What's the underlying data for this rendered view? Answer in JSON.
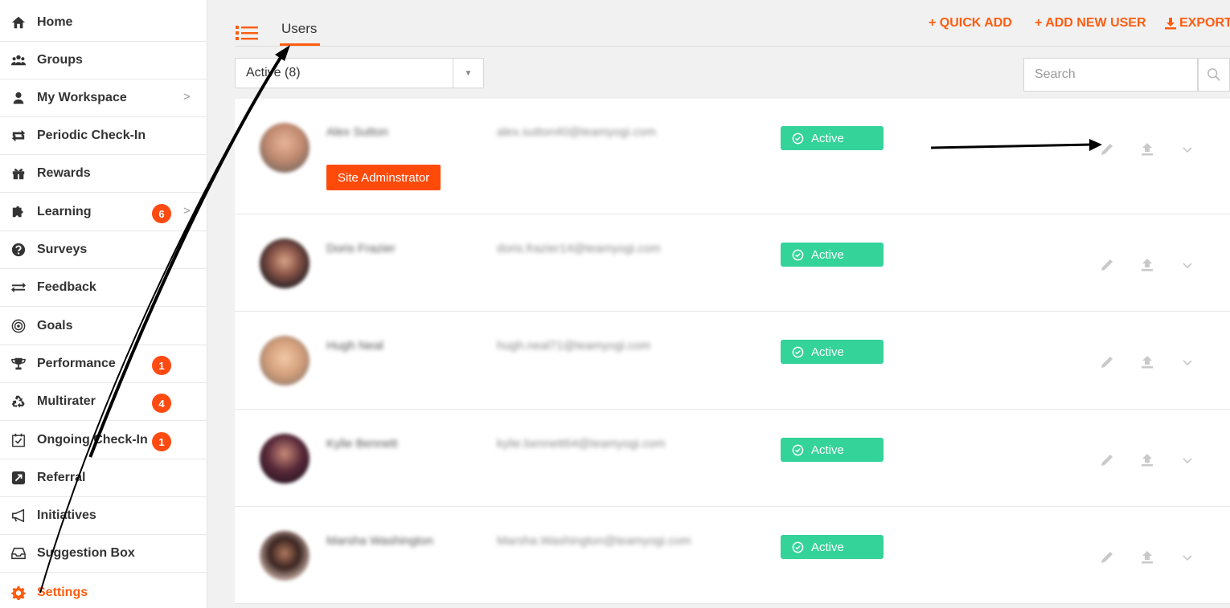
{
  "sidebar": {
    "items": [
      {
        "label": "Home",
        "icon": "home-icon"
      },
      {
        "label": "Groups",
        "icon": "groups-icon"
      },
      {
        "label": "My Workspace",
        "icon": "user-icon",
        "chevron": ">"
      },
      {
        "label": "Periodic Check-In",
        "icon": "cycle-arrows-icon"
      },
      {
        "label": "Rewards",
        "icon": "gift-icon"
      },
      {
        "label": "Learning",
        "icon": "puzzle-icon",
        "badge": "6",
        "chevron": ">"
      },
      {
        "label": "Surveys",
        "icon": "question-icon"
      },
      {
        "label": "Feedback",
        "icon": "exchange-arrows-icon"
      },
      {
        "label": "Goals",
        "icon": "target-icon"
      },
      {
        "label": "Performance",
        "icon": "trophy-icon",
        "badge": "1"
      },
      {
        "label": "Multirater",
        "icon": "recycle-icon",
        "badge": "4"
      },
      {
        "label": "Ongoing Check-In",
        "icon": "calendar-check-icon",
        "badge": "1"
      },
      {
        "label": "Referral",
        "icon": "share-box-icon"
      },
      {
        "label": "Initiatives",
        "icon": "megaphone-icon"
      },
      {
        "label": "Suggestion Box",
        "icon": "inbox-icon"
      },
      {
        "label": "Settings",
        "icon": "gear-icon",
        "active": true
      }
    ]
  },
  "header": {
    "tab_label": "Users",
    "quick_add": "+ QUICK ADD",
    "add_new_user": "+ ADD NEW USER",
    "export": "EXPORT"
  },
  "filter": {
    "selected": "Active (8)"
  },
  "search": {
    "placeholder": "Search"
  },
  "users": [
    {
      "name": "Alex Sutton",
      "email": "alex.sutton40@teamyogi.com",
      "status": "Active",
      "role": "Site Adminstrator"
    },
    {
      "name": "Doris Frazier",
      "email": "doris.frazier14@teamyogi.com",
      "status": "Active"
    },
    {
      "name": "Hugh Neal",
      "email": "hugh.neal71@teamyogi.com",
      "status": "Active"
    },
    {
      "name": "Kylie Bennett",
      "email": "kylie.bennett64@teamyogi.com",
      "status": "Active"
    },
    {
      "name": "Marsha Washington",
      "email": "Marsha.Washington@teamyogi.com",
      "status": "Active"
    }
  ],
  "colors": {
    "accent": "#ff5c0f",
    "badge": "#ff4a12",
    "status": "#33d39a",
    "role": "#ff4a0a"
  }
}
